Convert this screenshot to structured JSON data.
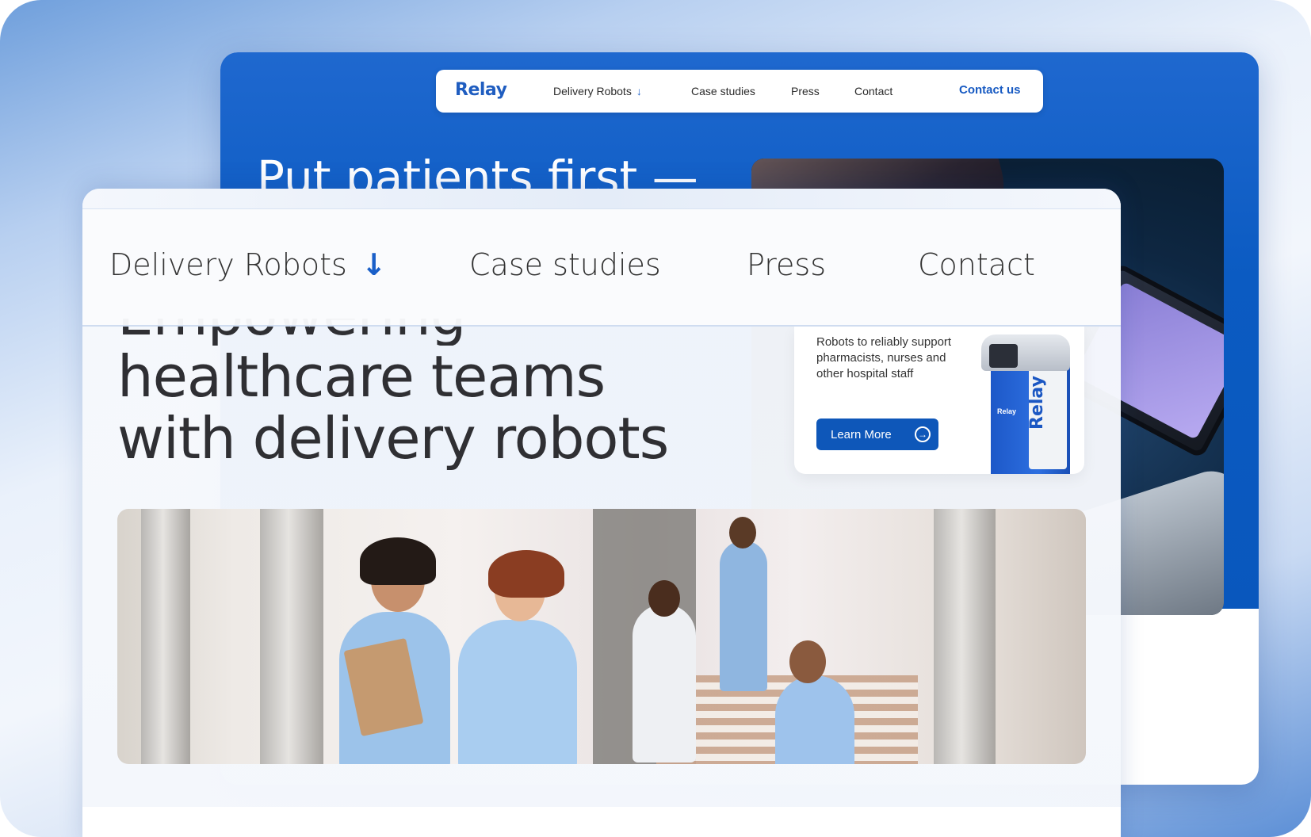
{
  "back_page": {
    "logo": "Relay",
    "nav": {
      "items": [
        "Delivery Robots",
        "Case studies",
        "Press",
        "Contact"
      ],
      "cta": "Contact us"
    },
    "headline": "Put patients first —"
  },
  "front_page": {
    "nav": {
      "items": [
        "Delivery Robots",
        "Case studies",
        "Press",
        "Contact"
      ]
    },
    "hero": {
      "line1_partial": "Empowering",
      "line2": "healthcare teams",
      "line3": "with delivery robots"
    },
    "promo": {
      "text": "Robots to reliably support pharmacists, nurses and other hospital staff",
      "button": "Learn More",
      "robot_brand": "Relay",
      "robot_small_brand": "Relay"
    }
  },
  "colors": {
    "brand_blue": "#0e57b9",
    "hero_blue": "#0b5bc2",
    "text_dark": "#2f2f33"
  },
  "icons": {
    "nav_dropdown": "arrow-down-icon",
    "button_arrow": "arrow-right-circle-icon"
  }
}
